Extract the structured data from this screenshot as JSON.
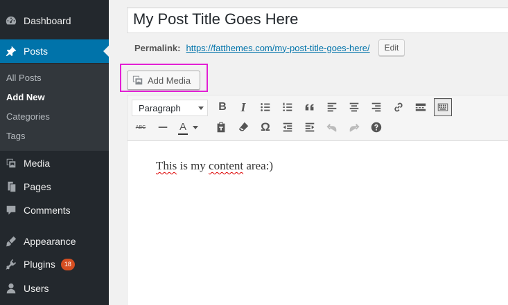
{
  "sidebar": {
    "items": [
      {
        "label": "Dashboard",
        "icon": "dashboard-icon"
      },
      {
        "label": "Posts",
        "icon": "pin-icon"
      },
      {
        "label": "Media",
        "icon": "media-icon"
      },
      {
        "label": "Pages",
        "icon": "pages-icon"
      },
      {
        "label": "Comments",
        "icon": "comments-icon"
      },
      {
        "label": "Appearance",
        "icon": "appearance-icon"
      },
      {
        "label": "Plugins",
        "icon": "plugins-icon",
        "badge": "18"
      },
      {
        "label": "Users",
        "icon": "users-icon"
      }
    ],
    "submenu": [
      "All Posts",
      "Add New",
      "Categories",
      "Tags"
    ],
    "active_item": "Posts",
    "current_subitem": "Add New",
    "accent_color": "#0073aa",
    "badge_color": "#d54e21"
  },
  "post": {
    "title": "My Post Title Goes Here",
    "permalink_label": "Permalink:",
    "permalink_url": "https://fatthemes.com/my-post-title-goes-here/",
    "edit_label": "Edit"
  },
  "media": {
    "add_media_label": "Add Media",
    "highlight_color": "#e21fd4"
  },
  "toolbar": {
    "format_select": "Paragraph",
    "row1_icons": [
      "bold-icon",
      "italic-icon",
      "bulleted-list-icon",
      "numbered-list-icon",
      "blockquote-icon",
      "align-left-icon",
      "align-center-icon",
      "align-right-icon",
      "link-icon",
      "read-more-icon",
      "toolbar-toggle-icon"
    ],
    "row2_icons": [
      "strikethrough-icon",
      "horizontal-line-icon",
      "text-color-icon",
      "paste-as-text-icon",
      "clear-formatting-icon",
      "special-character-icon",
      "outdent-icon",
      "indent-icon",
      "undo-icon",
      "redo-icon",
      "help-icon"
    ],
    "bold_glyph": "B",
    "italic_glyph": "I",
    "strike_glyph": "ABC",
    "text_color_glyph": "A",
    "omega_glyph": "Ω"
  },
  "editor": {
    "content_pre": "This",
    "content_mid": " is my ",
    "content_word": "content",
    "content_post": " area:)"
  }
}
